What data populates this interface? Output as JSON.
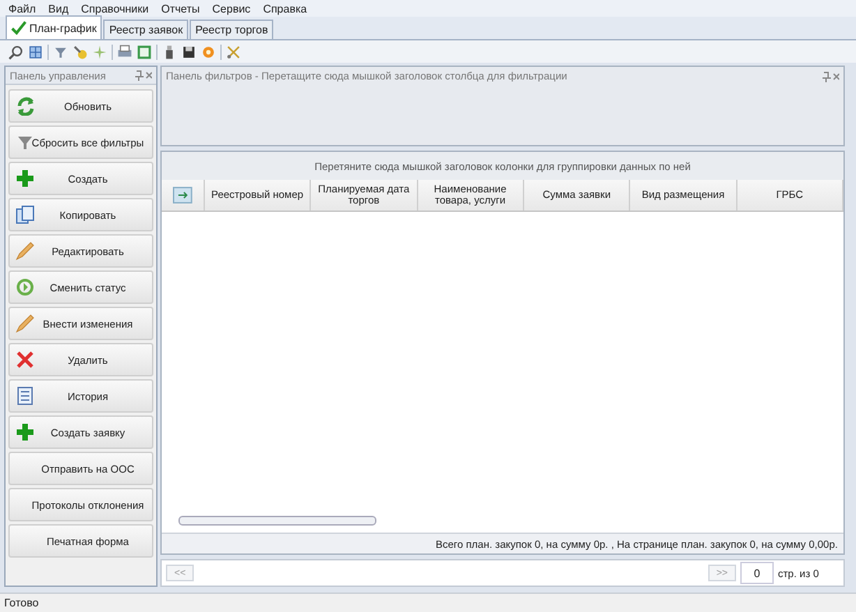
{
  "menu": [
    "Файл",
    "Вид",
    "Справочники",
    "Отчеты",
    "Сервис",
    "Справка"
  ],
  "tabs": [
    {
      "label": "План-график",
      "selected": true
    },
    {
      "label": "Реестр заявок",
      "selected": false
    },
    {
      "label": "Реестр торгов",
      "selected": false
    }
  ],
  "control_panel": {
    "title": "Панель управления",
    "buttons": [
      {
        "label": "Обновить",
        "kind": "refresh"
      },
      {
        "label": "Сбросить все фильтры",
        "kind": "filter"
      },
      {
        "label": "Создать",
        "kind": "plus"
      },
      {
        "label": "Копировать",
        "kind": "copy"
      },
      {
        "label": "Редактировать",
        "kind": "pencil"
      },
      {
        "label": "Сменить статус",
        "kind": "status"
      },
      {
        "label": "Внести изменения",
        "kind": "pencil"
      },
      {
        "label": "Удалить",
        "kind": "cross"
      },
      {
        "label": "История",
        "kind": "document"
      },
      {
        "label": "Создать заявку",
        "kind": "plus"
      },
      {
        "label": "Отправить на ООС",
        "kind": "plain"
      },
      {
        "label": "Протоколы отклонения",
        "kind": "plain"
      },
      {
        "label": "Печатная форма",
        "kind": "plain"
      }
    ]
  },
  "filter_panel": {
    "title": "Панель фильтров - Перетащите сюда мышкой заголовок столбца для фильтрации"
  },
  "grid": {
    "group_hint": "Перетяните сюда мышкой заголовок колонки для группировки данных по ней",
    "columns": [
      "Реестровый номер",
      "Планируемая дата торгов",
      "Наименование товара, услуги",
      "Сумма заявки",
      "Вид размещения",
      "ГРБС"
    ],
    "summary": "Всего план. закупок 0,  на сумму  0р. , На странице план. закупок 0,  на сумму 0,00р."
  },
  "pager": {
    "prev": "<<",
    "next": ">>",
    "page": "0",
    "of_label": "стр. из 0"
  },
  "status_bar": "Готово"
}
